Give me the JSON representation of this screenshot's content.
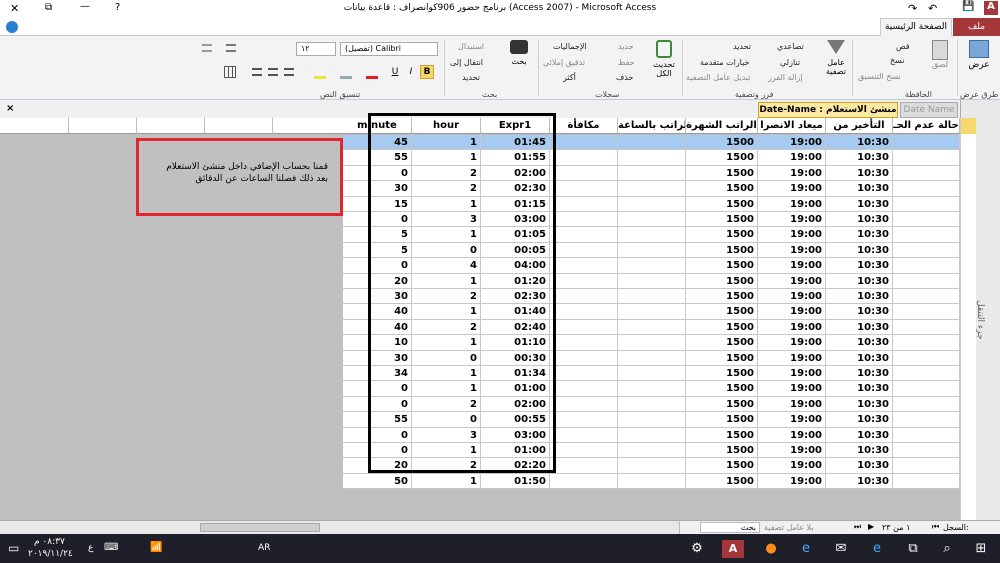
{
  "window": {
    "title": "برنامج حضور 906كوانصراف : قاعدة بيانات (Access 2007) - Microsoft Access",
    "close": "✕",
    "restore": "⧉",
    "minimize": "—",
    "help": "?"
  },
  "quick_access": {
    "undo": "↶",
    "redo": "↷",
    "save": "💾",
    "app": "A"
  },
  "tabs": [
    "ملف",
    "الصفحة الرئيسية"
  ],
  "ribbon": {
    "views": {
      "label": "عرض",
      "group": "طرق عرض"
    },
    "clipboard": {
      "paste": "لصق",
      "cut": "قص",
      "copy": "نسخ",
      "painter": "نسخ التنسيق",
      "group": "الحافظة"
    },
    "sort_filter": {
      "filter": "عامل تصفية",
      "asc": "تصاعدي",
      "desc": "تنازلي",
      "remove": "إزالة الفرز",
      "selection": "تحديد",
      "advanced": "خيارات متقدمة",
      "toggle": "تبديل عامل التصفية",
      "group": "فرز وتصفية"
    },
    "records": {
      "refresh": "تحديث الكل",
      "new": "جديد",
      "save": "حفظ",
      "delete": "حذف",
      "totals": "الإجماليات",
      "spelling": "تدقيق إملائي",
      "more": "أكثر",
      "group": "سجلات"
    },
    "find": {
      "find": "بحث",
      "replace": "استبدال",
      "goto": "انتقال إلى",
      "select": "تحديد",
      "group": "بحث"
    },
    "text_format": {
      "font": "(تفصيل) Calibri",
      "size": "١٢",
      "bold": "B",
      "italic": "I",
      "underline": "U",
      "group": "تنسيق النص"
    }
  },
  "doc_tabs": [
    "Date-Name : منشئ الاستعلام",
    "Date Name"
  ],
  "nav_pane_label": "جزء التنقل",
  "columns": [
    "حالة عدم الحـ",
    "التأخير من",
    "ميعاد الانصرا",
    "الراتب الشهرة",
    "الراتب بالساعة",
    "مكافأة",
    "Expr1",
    "hour",
    "minute"
  ],
  "rows": [
    {
      "late": "10:30",
      "leave": "19:00",
      "salary": "1500",
      "expr": "01:45",
      "hour": "1",
      "minute": "45"
    },
    {
      "late": "10:30",
      "leave": "19:00",
      "salary": "1500",
      "expr": "01:55",
      "hour": "1",
      "minute": "55"
    },
    {
      "late": "10:30",
      "leave": "19:00",
      "salary": "1500",
      "expr": "02:00",
      "hour": "2",
      "minute": "0"
    },
    {
      "late": "10:30",
      "leave": "19:00",
      "salary": "1500",
      "expr": "02:30",
      "hour": "2",
      "minute": "30"
    },
    {
      "late": "10:30",
      "leave": "19:00",
      "salary": "1500",
      "expr": "01:15",
      "hour": "1",
      "minute": "15"
    },
    {
      "late": "10:30",
      "leave": "19:00",
      "salary": "1500",
      "expr": "03:00",
      "hour": "3",
      "minute": "0"
    },
    {
      "late": "10:30",
      "leave": "19:00",
      "salary": "1500",
      "expr": "01:05",
      "hour": "1",
      "minute": "5"
    },
    {
      "late": "10:30",
      "leave": "19:00",
      "salary": "1500",
      "expr": "00:05",
      "hour": "0",
      "minute": "5"
    },
    {
      "late": "10:30",
      "leave": "19:00",
      "salary": "1500",
      "expr": "04:00",
      "hour": "4",
      "minute": "0"
    },
    {
      "late": "10:30",
      "leave": "19:00",
      "salary": "1500",
      "expr": "01:20",
      "hour": "1",
      "minute": "20"
    },
    {
      "late": "10:30",
      "leave": "19:00",
      "salary": "1500",
      "expr": "02:30",
      "hour": "2",
      "minute": "30"
    },
    {
      "late": "10:30",
      "leave": "19:00",
      "salary": "1500",
      "expr": "01:40",
      "hour": "1",
      "minute": "40"
    },
    {
      "late": "10:30",
      "leave": "19:00",
      "salary": "1500",
      "expr": "02:40",
      "hour": "2",
      "minute": "40"
    },
    {
      "late": "10:30",
      "leave": "19:00",
      "salary": "1500",
      "expr": "01:10",
      "hour": "1",
      "minute": "10"
    },
    {
      "late": "10:30",
      "leave": "19:00",
      "salary": "1500",
      "expr": "00:30",
      "hour": "0",
      "minute": "30"
    },
    {
      "late": "10:30",
      "leave": "19:00",
      "salary": "1500",
      "expr": "01:34",
      "hour": "1",
      "minute": "34"
    },
    {
      "late": "10:30",
      "leave": "19:00",
      "salary": "1500",
      "expr": "01:00",
      "hour": "1",
      "minute": "0"
    },
    {
      "late": "10:30",
      "leave": "19:00",
      "salary": "1500",
      "expr": "02:00",
      "hour": "2",
      "minute": "0"
    },
    {
      "late": "10:30",
      "leave": "19:00",
      "salary": "1500",
      "expr": "00:55",
      "hour": "0",
      "minute": "55"
    },
    {
      "late": "10:30",
      "leave": "19:00",
      "salary": "1500",
      "expr": "03:00",
      "hour": "3",
      "minute": "0"
    },
    {
      "late": "10:30",
      "leave": "19:00",
      "salary": "1500",
      "expr": "01:00",
      "hour": "1",
      "minute": "0"
    },
    {
      "late": "10:30",
      "leave": "19:00",
      "salary": "1500",
      "expr": "02:20",
      "hour": "2",
      "minute": "20"
    },
    {
      "late": "10:30",
      "leave": "19:00",
      "salary": "1500",
      "expr": "01:50",
      "hour": "1",
      "minute": "50"
    }
  ],
  "annotation": {
    "line1": "قمنا بحساب الإضافي داخل منشئ الاستعلام",
    "line2": "بعد ذلك فصلنا الساعات عن الدقائق"
  },
  "status": {
    "record_label": "السجل:",
    "record_pos": "١ ﻣﻦ ٢٣",
    "filter": "بلا عامل تصفية",
    "search": "بحث"
  },
  "taskbar": {
    "time": "٠٨:٣٧ م",
    "date": "٢٠١٩/١١/٢٤",
    "lang": "AR",
    "lang2": "ع"
  },
  "colors": {
    "accent": "#a4373a",
    "selection": "#a6caf0",
    "highlight_box": "#000000",
    "note_box": "#e0262c"
  }
}
